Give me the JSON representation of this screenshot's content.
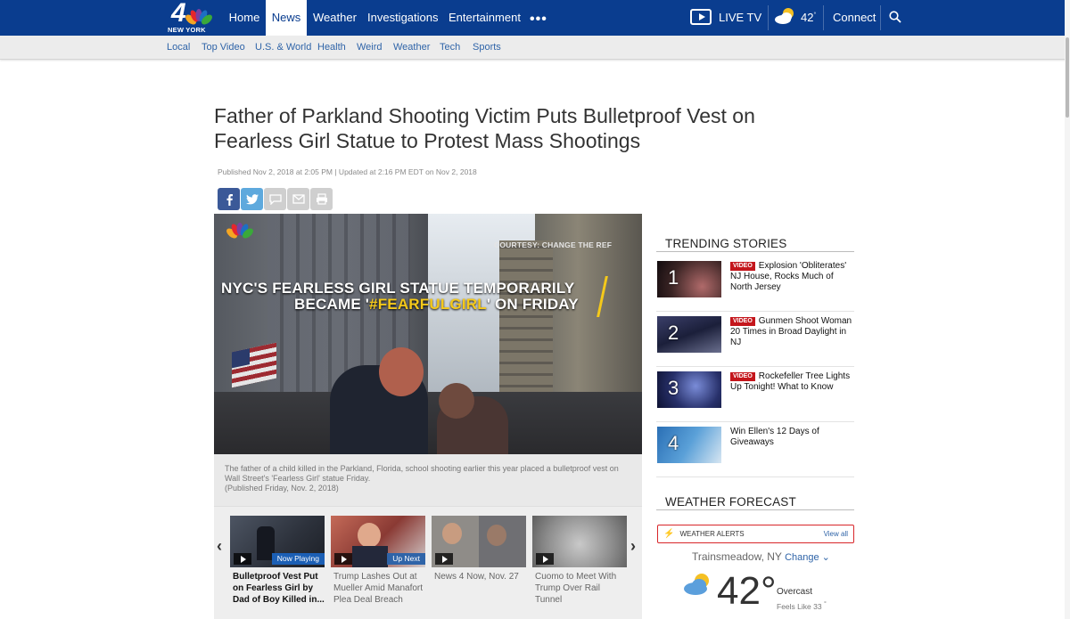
{
  "header": {
    "logo": {
      "channel": "4",
      "city": "NEW YORK"
    },
    "nav": [
      "Home",
      "News",
      "Weather",
      "Investigations",
      "Entertainment"
    ],
    "active_nav": "News",
    "more": "•••",
    "live_tv": "LIVE TV",
    "temp": "42",
    "temp_unit": "°",
    "connect": "Connect"
  },
  "subnav": [
    "Local",
    "Top Video",
    "U.S. & World",
    "Health",
    "Weird",
    "Weather",
    "Tech",
    "Sports"
  ],
  "article": {
    "headline": "Father of Parkland Shooting Victim Puts Bulletproof Vest on Fearless Girl Statue to Protest Mass Shootings",
    "dateline": "Published Nov 2, 2018 at 2:05 PM | Updated at 2:16 PM EDT on Nov 2, 2018",
    "share_icons": [
      "facebook-icon",
      "twitter-icon",
      "comment-icon",
      "email-icon",
      "print-icon"
    ]
  },
  "video": {
    "courtesy": "COURTESY: CHANGE THE REF",
    "caption_line1": "NYC'S FEARLESS GIRL STATUE TEMPORARILY",
    "caption_line2_pre": "BECAME '",
    "caption_line2_hl": "#FEARFULGIRL",
    "caption_line2_post": "' ON FRIDAY",
    "description": "The father of a child killed in the Parkland, Florida, school shooting earlier this year placed a bulletproof vest on Wall Street's 'Fearless Girl' statue Friday.",
    "published": "(Published Friday, Nov. 2, 2018)"
  },
  "carousel": {
    "prev": "‹",
    "next": "›",
    "items": [
      {
        "title": "Bulletproof Vest Put on Fearless Girl by Dad of Boy Killed in...",
        "tag": "Now Playing"
      },
      {
        "title": "Trump Lashes Out at Mueller Amid Manafort Plea Deal Breach",
        "tag": "Up Next"
      },
      {
        "title": "News 4 Now, Nov. 27",
        "tag": ""
      },
      {
        "title": "Cuomo to Meet With Trump Over Rail Tunnel",
        "tag": ""
      }
    ]
  },
  "trending": {
    "heading": "TRENDING STORIES",
    "video_tag": "VIDEO",
    "items": [
      {
        "num": "1",
        "title": "Explosion 'Obliterates' NJ House, Rocks Much of North Jersey",
        "video": true
      },
      {
        "num": "2",
        "title": "Gunmen Shoot Woman 20 Times in Broad Daylight in NJ",
        "video": true
      },
      {
        "num": "3",
        "title": "Rockefeller Tree Lights Up Tonight! What to Know",
        "video": true
      },
      {
        "num": "4",
        "title": "Win Ellen's 12 Days of Giveaways",
        "video": false
      }
    ]
  },
  "weather": {
    "heading": "WEATHER FORECAST",
    "alerts": "WEATHER ALERTS",
    "view_all": "View all",
    "location": "Trainsmeadow, NY",
    "change": "Change",
    "temp": "42",
    "deg": "°",
    "condition": "Overcast",
    "feels": "Feels Like 33",
    "feels_unit": "°"
  },
  "colors": {
    "nav_bg": "#0a3d8f",
    "link": "#2f64a8",
    "alert_red": "#d8262a",
    "video_tag": "#c4161c"
  }
}
